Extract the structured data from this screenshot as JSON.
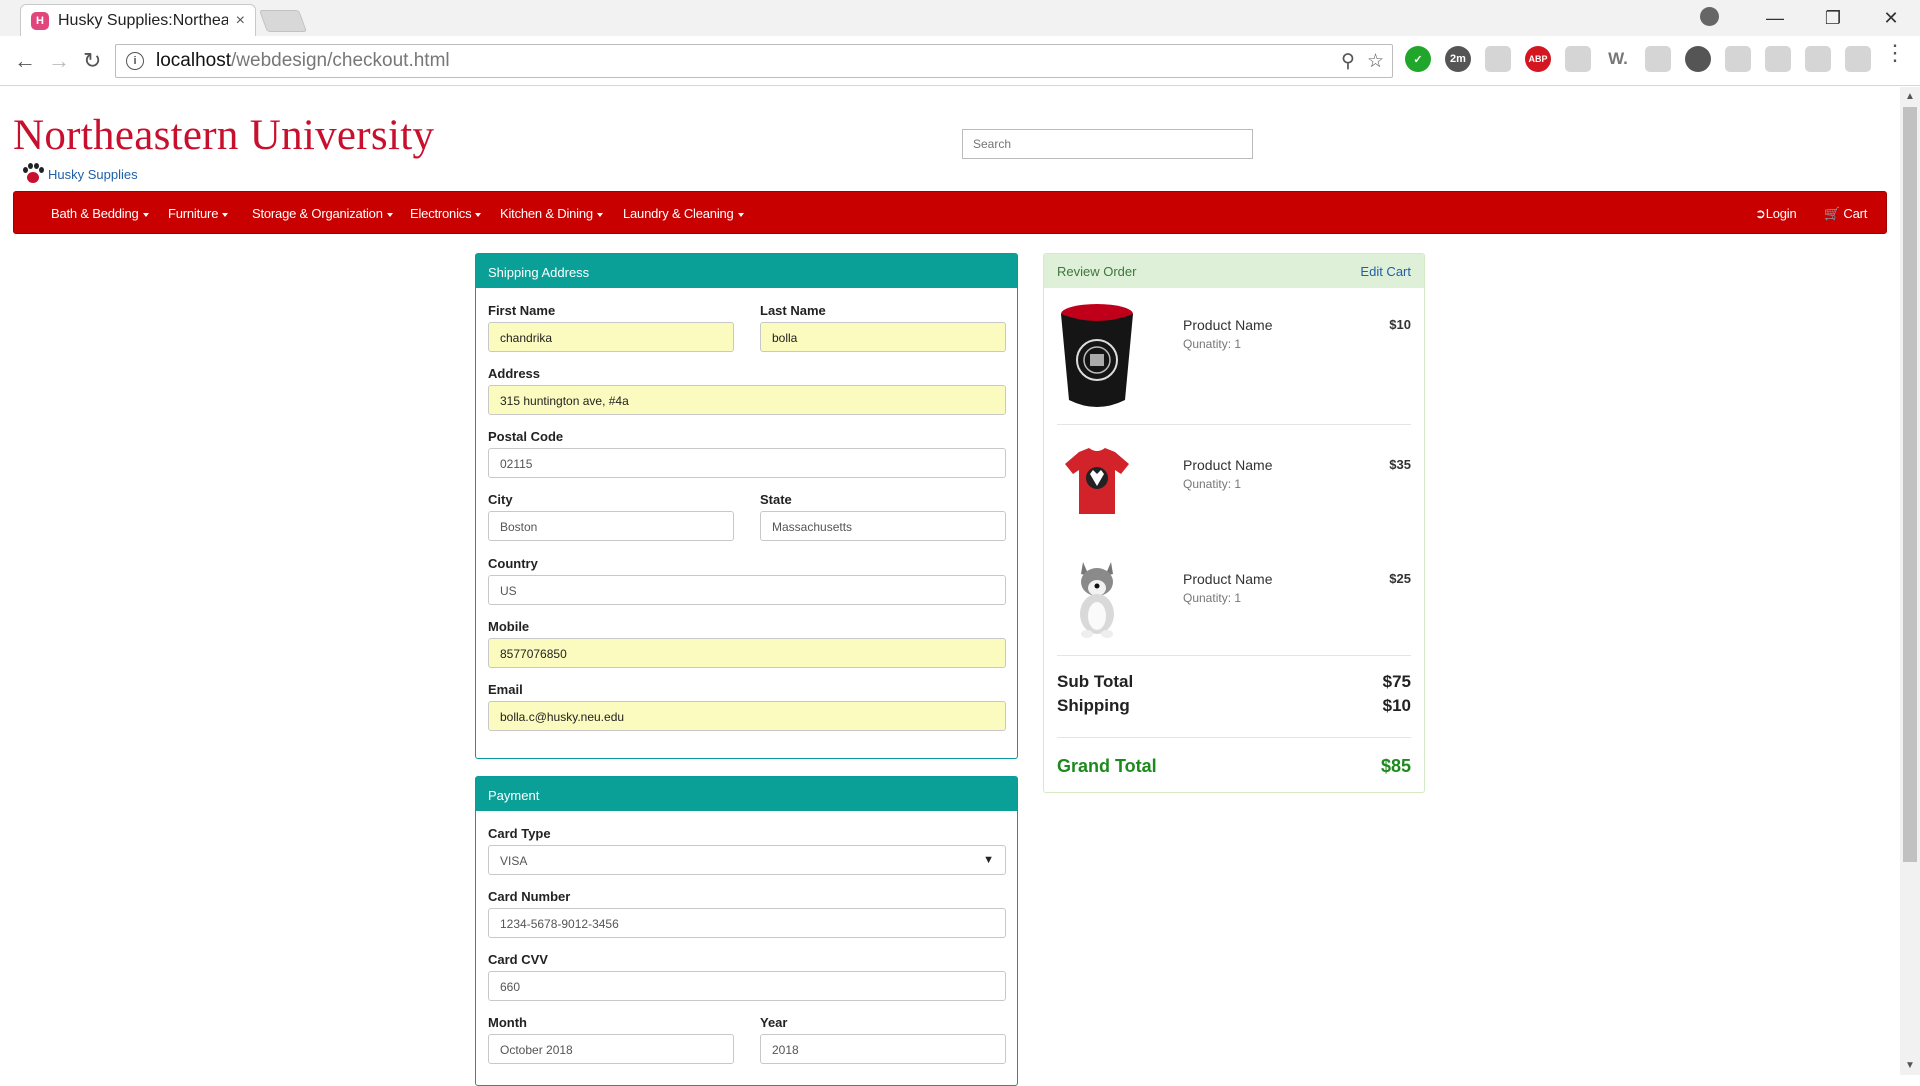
{
  "browser": {
    "tab_title": "Husky Supplies:Northeas",
    "tab_close": "×",
    "url_host": "localhost",
    "url_path": "/webdesign/checkout.html",
    "extension_badge": "2m",
    "extension_abp": "ABP",
    "extension_w": "W."
  },
  "site": {
    "brand": "Northeastern University",
    "subbrand": "Husky Supplies",
    "search_placeholder": "Search"
  },
  "nav": {
    "items": [
      "Bath & Bedding",
      "Furniture",
      "Storage & Organization",
      "Electronics",
      "Kitchen & Dining",
      "Laundry & Cleaning"
    ],
    "login": "Login",
    "cart": "Cart"
  },
  "shipping": {
    "heading": "Shipping Address",
    "first_name_label": "First Name",
    "first_name": "chandrika",
    "last_name_label": "Last Name",
    "last_name": "bolla",
    "address_label": "Address",
    "address": "315 huntington ave, #4a",
    "postal_label": "Postal Code",
    "postal": "02115",
    "city_label": "City",
    "city": "Boston",
    "state_label": "State",
    "state": "Massachusetts",
    "country_label": "Country",
    "country": "US",
    "mobile_label": "Mobile",
    "mobile": "8577076850",
    "email_label": "Email",
    "email": "bolla.c@husky.neu.edu"
  },
  "payment": {
    "heading": "Payment",
    "card_type_label": "Card Type",
    "card_type": "VISA",
    "card_number_label": "Card Number",
    "card_number": "1234-5678-9012-3456",
    "cvv_label": "Card CVV",
    "cvv": "660",
    "month_label": "Month",
    "month": "October 2018",
    "year_label": "Year",
    "year": "2018"
  },
  "review": {
    "heading": "Review Order",
    "edit": "Edit Cart",
    "items": [
      {
        "name": "Product Name",
        "qty": "Qunatity: 1",
        "price": "$10",
        "image": "mug-image"
      },
      {
        "name": "Product Name",
        "qty": "Qunatity: 1",
        "price": "$35",
        "image": "tshirt-image"
      },
      {
        "name": "Product Name",
        "qty": "Qunatity: 1",
        "price": "$25",
        "image": "husky-plush-image"
      }
    ],
    "subtotal_label": "Sub Total",
    "subtotal": "$75",
    "shipping_label": "Shipping",
    "shipping": "$10",
    "grand_label": "Grand Total",
    "grand": "$85"
  },
  "colors": {
    "brand_red": "#c8102e",
    "navbar_red": "#c80000",
    "panel_teal": "#0aa098",
    "review_green": "#dff0d8",
    "autofill_yellow": "#fbfbbf",
    "total_green": "#1d8a1d"
  }
}
